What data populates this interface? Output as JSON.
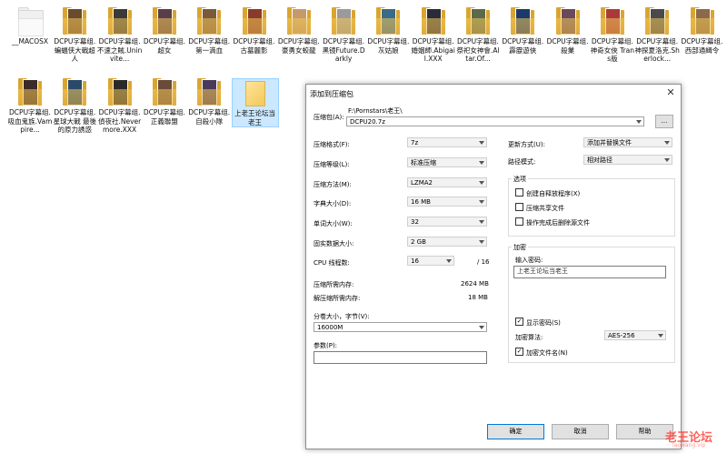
{
  "desktop": {
    "row1": [
      {
        "label": "__MACOSX",
        "plain": true
      },
      {
        "label": "DCPU字幕组.蝙蝠侠大戰超人",
        "color": "#6b4a2f"
      },
      {
        "label": "DCPU字幕组.不速之賊.Uninvite...",
        "color": "#3a3a3a"
      },
      {
        "label": "DCPU字幕组.超女",
        "color": "#5a3d4a"
      },
      {
        "label": "DCPU字幕组.第一滴血",
        "color": "#7a5a3a"
      },
      {
        "label": "DCPU字幕组.古墓麗影",
        "color": "#8a3a2a"
      },
      {
        "label": "DCPU字幕组.豪勇女蛟龍",
        "color": "#c49a6a"
      },
      {
        "label": "DCPU字幕组.黑镜Future.Darkly",
        "color": "#9a9a9a"
      },
      {
        "label": "DCPU字幕组.灰姑娘",
        "color": "#3a6a8a"
      },
      {
        "label": "DCPU字幕组.婚姻師.Abigail.XXX",
        "color": "#2a2a3a"
      },
      {
        "label": "DCPU字幕组.祭祀女神會.Altar.Of...",
        "color": "#5a6a4a"
      },
      {
        "label": "DCPU字幕组.霹靂遊俠",
        "color": "#1a3a6a"
      },
      {
        "label": "DCPU字幕组.殺業",
        "color": "#6a4a5a"
      },
      {
        "label": "DCPU字幕组.神奇女俠 Trans版",
        "color": "#aa3a3a"
      },
      {
        "label": "DCPU字幕组.神探夏洛克.Sherlock...",
        "color": "#4a4a4a"
      },
      {
        "label": "DCPU字幕组.西部通緝令",
        "color": "#8a6a4a"
      }
    ],
    "row2": [
      {
        "label": "DCPU字幕组.吸血鬼族.Vampire...",
        "color": "#3a2a2a"
      },
      {
        "label": "DCPU字幕组.星球大戰 最後的原力誘惑",
        "color": "#2a4a6a"
      },
      {
        "label": "DCPU字幕组.偵夜社.Nevermore.XXX",
        "color": "#2a2a2a"
      },
      {
        "label": "DCPU字幕组.正義聯盟",
        "color": "#6a4a3a"
      },
      {
        "label": "DCPU字幕组.自殺小隊",
        "color": "#4a3a5a"
      },
      {
        "label": "上老王论坛当老王",
        "selected": true
      }
    ]
  },
  "dialog": {
    "title": "添加到压缩包",
    "close": "✕",
    "archive_label": "压缩包(A):",
    "archive_path": "F:\\Pornstars\\老王\\",
    "archive_name": "DCPU20.7z",
    "browse": "...",
    "format_label": "压缩格式(F):",
    "format_value": "7z",
    "level_label": "压缩等级(L):",
    "level_value": "标准压缩",
    "method_label": "压缩方法(M):",
    "method_value": "LZMA2",
    "dict_label": "字典大小(D):",
    "dict_value": "16 MB",
    "word_label": "单词大小(W):",
    "word_value": "32",
    "solid_label": "固实数据大小:",
    "solid_value": "2 GB",
    "cpu_label": "CPU 线程数:",
    "cpu_value": "16",
    "cpu_total": "/ 16",
    "mem_comp_label": "压缩所需内存:",
    "mem_comp_value": "2624 MB",
    "mem_decomp_label": "解压缩所需内存:",
    "mem_decomp_value": "18 MB",
    "split_label": "分卷大小，字节(V):",
    "split_value": "16000M",
    "params_label": "参数(P):",
    "params_value": "",
    "update_label": "更新方式(U):",
    "update_value": "添加并替换文件",
    "path_label": "路径模式:",
    "path_value": "相对路径",
    "options_title": "选项",
    "opt_sfx": "创建自释放程序(X)",
    "opt_shared": "压缩共享文件",
    "opt_delete": "操作完成后删除源文件",
    "encrypt_title": "加密",
    "password_label": "输入密码:",
    "password_value": "上老王论坛当老王",
    "show_password": "显示密码(S)",
    "enc_method_label": "加密算法:",
    "enc_method_value": "AES-256",
    "encrypt_names": "加密文件名(N)",
    "ok": "确定",
    "cancel": "取消",
    "help": "帮助"
  },
  "watermark": {
    "text": "老王论坛",
    "sub": "laowang.vip"
  }
}
